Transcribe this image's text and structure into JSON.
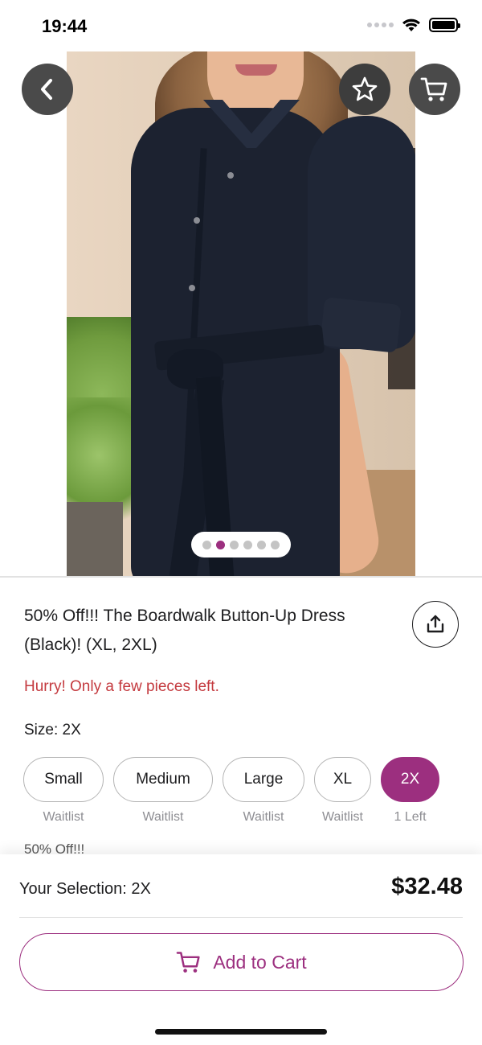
{
  "status_bar": {
    "time": "19:44"
  },
  "product": {
    "title": "50% Off!!! The Boardwalk Button-Up Dress (Black)! (XL, 2XL)",
    "stock_note": "Hurry! Only a few pieces left.",
    "description_peek": "50% Off!!!",
    "gallery": {
      "image_count": 6,
      "active_index": 1
    }
  },
  "size": {
    "label": "Size: 2X",
    "options": [
      {
        "label": "Small",
        "status": "Waitlist",
        "selected": false
      },
      {
        "label": "Medium",
        "status": "Waitlist",
        "selected": false
      },
      {
        "label": "Large",
        "status": "Waitlist",
        "selected": false
      },
      {
        "label": "XL",
        "status": "Waitlist",
        "selected": false
      },
      {
        "label": "2X",
        "status": "1 Left",
        "selected": true
      }
    ]
  },
  "footer": {
    "selection_label": "Your Selection: 2X",
    "price": "$32.48",
    "add_to_cart_label": "Add to Cart"
  },
  "colors": {
    "accent": "#9c2f7f",
    "alert": "#c43a3f"
  }
}
